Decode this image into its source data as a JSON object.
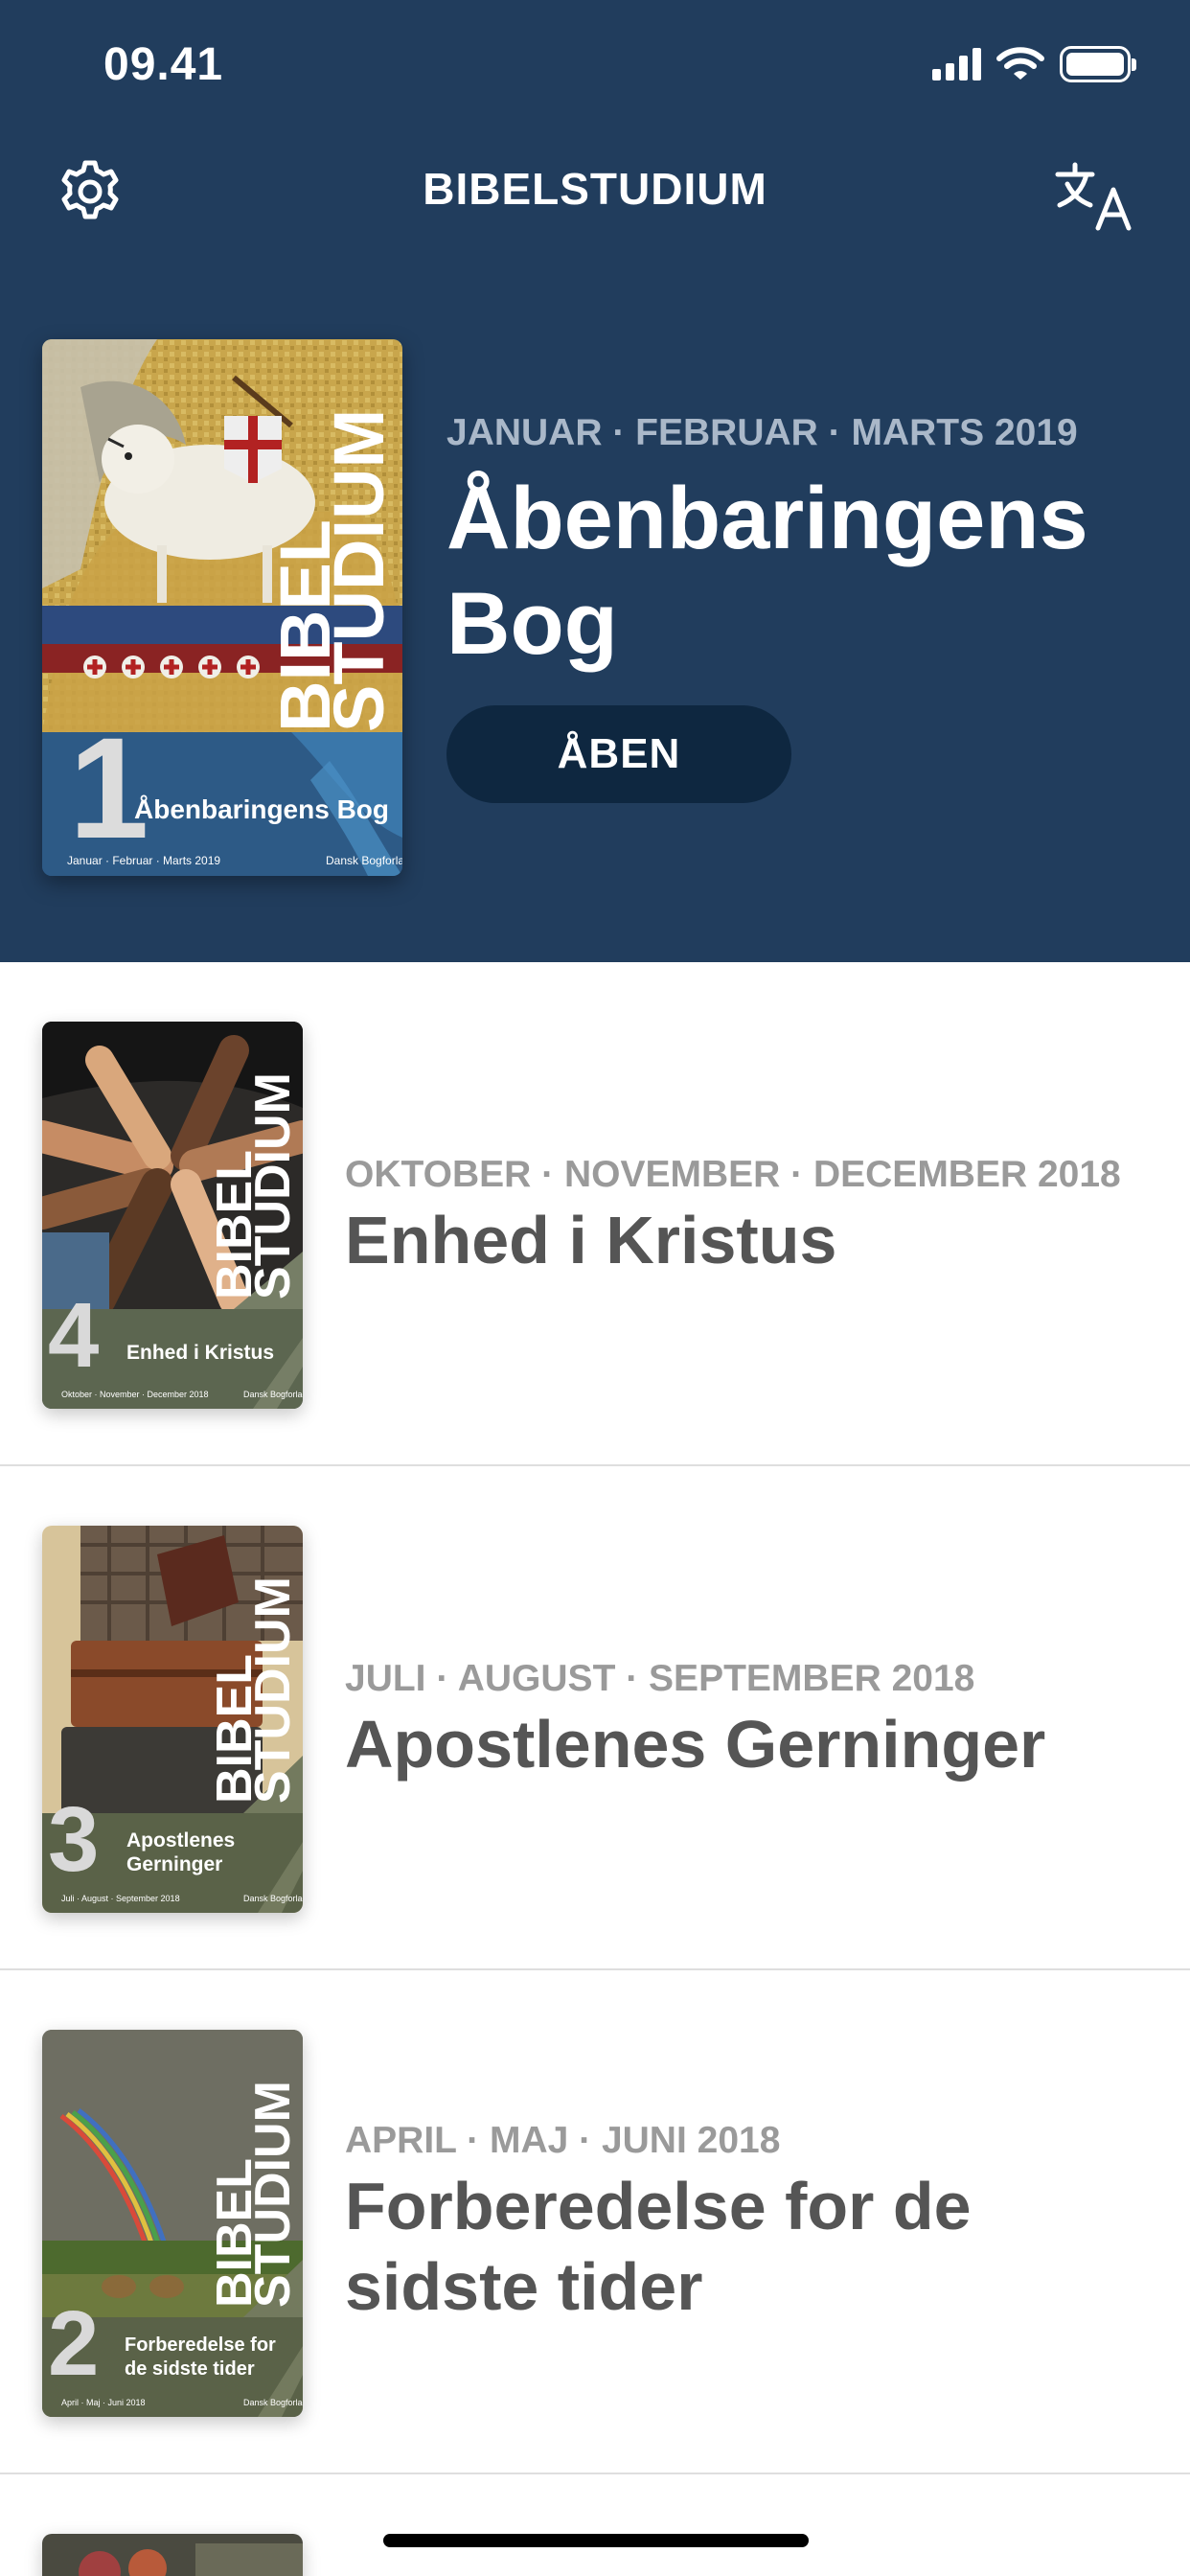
{
  "status_bar": {
    "time": "09.41"
  },
  "nav": {
    "title": "BIBELSTUDIUM"
  },
  "icons": {
    "settings": "gear-icon",
    "language": "translate-icon"
  },
  "colors": {
    "header_bg": "#213d5d",
    "button_bg": "#0e2740"
  },
  "featured": {
    "period": "JANUAR · FEBRUAR · MARTS 2019",
    "title": "Åbenbaringens Bog",
    "open_label": "ÅBEN",
    "cover": {
      "brand": "BIBEL STUDIUM",
      "number": "1",
      "title": "Åbenbaringens Bog",
      "period": "Januar · Februar · Marts 2019",
      "publisher": "Dansk Bogforlag"
    }
  },
  "lessons": [
    {
      "period": "OKTOBER · NOVEMBER · DECEMBER 2018",
      "title": "Enhed i Kristus",
      "cover": {
        "number": "4",
        "title": "Enhed i Kristus",
        "period": "Oktober · November · December 2018",
        "publisher": "Dansk Bogforlag"
      }
    },
    {
      "period": "JULI · AUGUST · SEPTEMBER 2018",
      "title": "Apostlenes Gerninger",
      "cover": {
        "number": "3",
        "title_line1": "Apostlenes",
        "title_line2": "Gerninger",
        "period": "Juli · August · September 2018",
        "publisher": "Dansk Bogforlag"
      }
    },
    {
      "period": "APRIL · MAJ · JUNI 2018",
      "title": "Forberedelse for de sidste tider",
      "cover": {
        "number": "2",
        "title_line1": "Forberedelse for",
        "title_line2": "de sidste tider",
        "period": "April · Maj · Juni 2018",
        "publisher": "Dansk Bogforlag"
      }
    }
  ]
}
